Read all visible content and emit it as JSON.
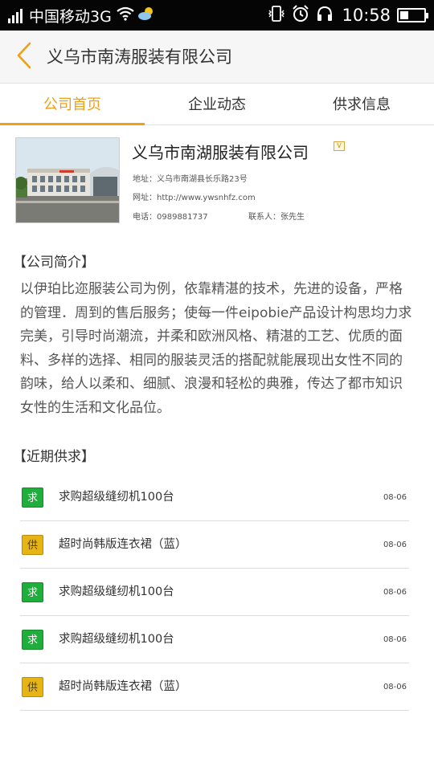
{
  "status_bar": {
    "carrier": "中国移动3G",
    "time": "10:58",
    "battery_level": 0.35,
    "icons": [
      "signal-icon",
      "wifi-icon",
      "weather-icon",
      "vibrate-icon",
      "alarm-icon",
      "headset-icon",
      "battery-icon"
    ]
  },
  "header": {
    "back_icon": "chevron-left-icon",
    "title": "义乌市南涛服装有限公司"
  },
  "tabs": [
    {
      "label": "公司首页",
      "active": true
    },
    {
      "label": "企业动态",
      "active": false
    },
    {
      "label": "供求信息",
      "active": false
    }
  ],
  "company": {
    "name": "义乌市南湖服装有限公司",
    "badge": "V",
    "address": "地址：义乌市南湖县长乐路23号",
    "website": "网址：http://www.ywsnhfz.com",
    "phone": "电话：0989881737",
    "contact": "联系人：张先生"
  },
  "intro": {
    "heading": "【公司简介】",
    "text": "以伊珀比迩服装公司为例，依靠精湛的技术，先进的设备，严格的管理．周到的售后服务；使每一件eipobie产品设计构思均力求完美，引导时尚潮流，并柔和欧洲风格、精湛的工艺、优质的面料、多样的选择、相同的服装灵活的搭配就能展现出女性不同的韵味，给人以柔和、细腻、浪漫和轻松的典雅，传达了都市知识女性的生活和文化品位。"
  },
  "supply": {
    "heading": "【近期供求】",
    "items": [
      {
        "type": "求",
        "kind": "demand",
        "title": "求购超级缝纫机100台",
        "date": "08-06"
      },
      {
        "type": "供",
        "kind": "supply",
        "title": "超时尚韩版连衣裙（蓝）",
        "date": "08-06"
      },
      {
        "type": "求",
        "kind": "demand",
        "title": "求购超级缝纫机100台",
        "date": "08-06"
      },
      {
        "type": "求",
        "kind": "demand",
        "title": "求购超级缝纫机100台",
        "date": "08-06"
      },
      {
        "type": "供",
        "kind": "supply",
        "title": "超时尚韩版连衣裙（蓝）",
        "date": "08-06"
      }
    ]
  },
  "colors": {
    "accent": "#f0a017",
    "demand": "#1fae3b",
    "supply": "#e7b416",
    "status_bar": "#050505"
  }
}
